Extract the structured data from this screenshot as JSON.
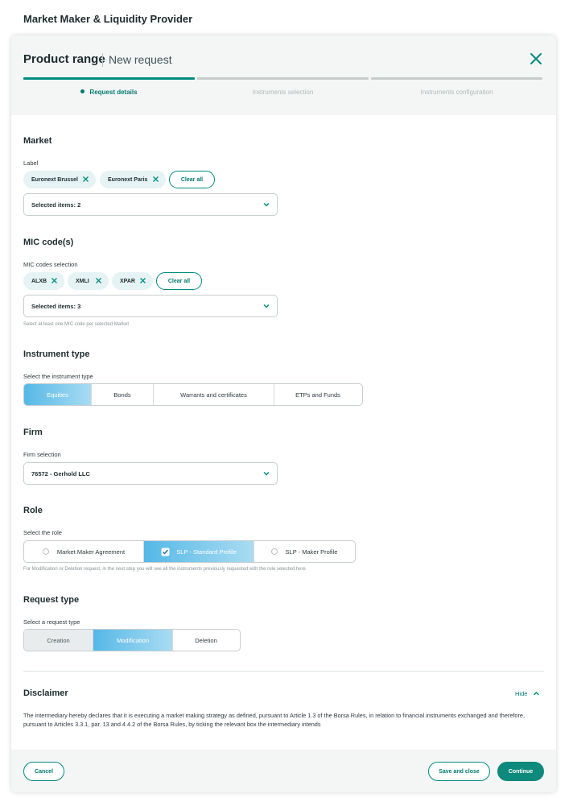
{
  "app": {
    "title": "Market Maker & Liquidity Provider"
  },
  "modal": {
    "title": "Product range",
    "subtitle": "New request",
    "steps": [
      {
        "label": "Request details",
        "active": true
      },
      {
        "label": "Instruments selection",
        "active": false
      },
      {
        "label": "Instruments configuration",
        "active": false
      }
    ]
  },
  "market": {
    "title": "Market",
    "label": "Label",
    "chips": [
      "Euronext Brussel",
      "Euronext Paris"
    ],
    "clear_all": "Clear all",
    "selected": "Selected items: 2"
  },
  "mic": {
    "title": "MIC code(s)",
    "label": "MIC codes selection",
    "chips": [
      "ALXB",
      "XMLI",
      "XPAR"
    ],
    "clear_all": "Clear all",
    "selected": "Selected items: 3",
    "helper": "Select at least one MIC code per selected Market"
  },
  "instrument": {
    "title": "Instrument type",
    "label": "Select the instrument type",
    "options": [
      "Equities",
      "Bonds",
      "Warrants and certificates",
      "ETPs and Funds"
    ],
    "selected": "Equities"
  },
  "firm": {
    "title": "Firm",
    "label": "Firm selection",
    "value": "76572 - Gerhold LLC"
  },
  "role": {
    "title": "Role",
    "label": "Select the role",
    "options": [
      "Market Maker Agreement",
      "SLP - Standard Profile",
      "SLP - Maker Profile"
    ],
    "selected": "SLP - Standard Profile",
    "helper": "For Modification or Deletion request, in the next step you will see all the instruments previously requested with the role selected here"
  },
  "request_type": {
    "title": "Request type",
    "label": "Select a request type",
    "options": [
      "Creation",
      "Modification",
      "Deletion"
    ],
    "selected": "Modification"
  },
  "disclaimer": {
    "title": "Disclaimer",
    "toggle": "Hide",
    "text": "The intermediary hereby declares that it is executing a market making strategy as defined, pursuant to Article 1.3 of the Borsa Rules, in relation to financial instruments exchanged and therefore, pursuant to Articles 3.3.1, par. 13 and 4.4.2 of the Borsa Rules, by ticking the relevant box the intermediary intends"
  },
  "footer": {
    "cancel": "Cancel",
    "save_close": "Save and close",
    "continue": "Continue"
  },
  "colors": {
    "accent": "#008d7f",
    "selected_gradient_start": "#55b8e6",
    "selected_gradient_end": "#a9dcf2"
  }
}
